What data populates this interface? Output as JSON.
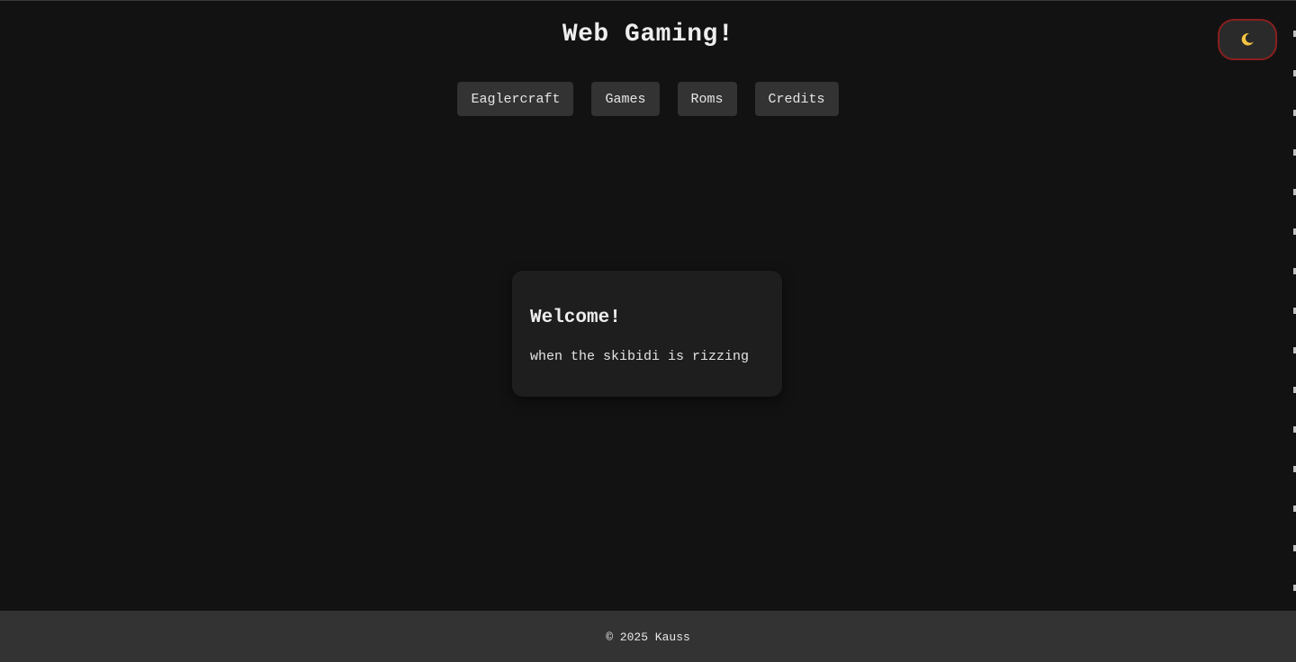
{
  "header": {
    "title": "Web Gaming!"
  },
  "theme_toggle": {
    "icon": "moon-icon",
    "border_color": "#8a1f1f",
    "icon_color": "#f5c542"
  },
  "nav": {
    "items": [
      {
        "label": "Eaglercraft"
      },
      {
        "label": "Games"
      },
      {
        "label": "Roms"
      },
      {
        "label": "Credits"
      }
    ]
  },
  "card": {
    "title": "Welcome!",
    "text": "when the skibidi is rizzing"
  },
  "footer": {
    "text": "© 2025 Kauss"
  },
  "colors": {
    "background": "#121212",
    "card": "#1e1e1e",
    "button": "#333333",
    "footer": "#333333",
    "text": "#e8e8e8"
  }
}
